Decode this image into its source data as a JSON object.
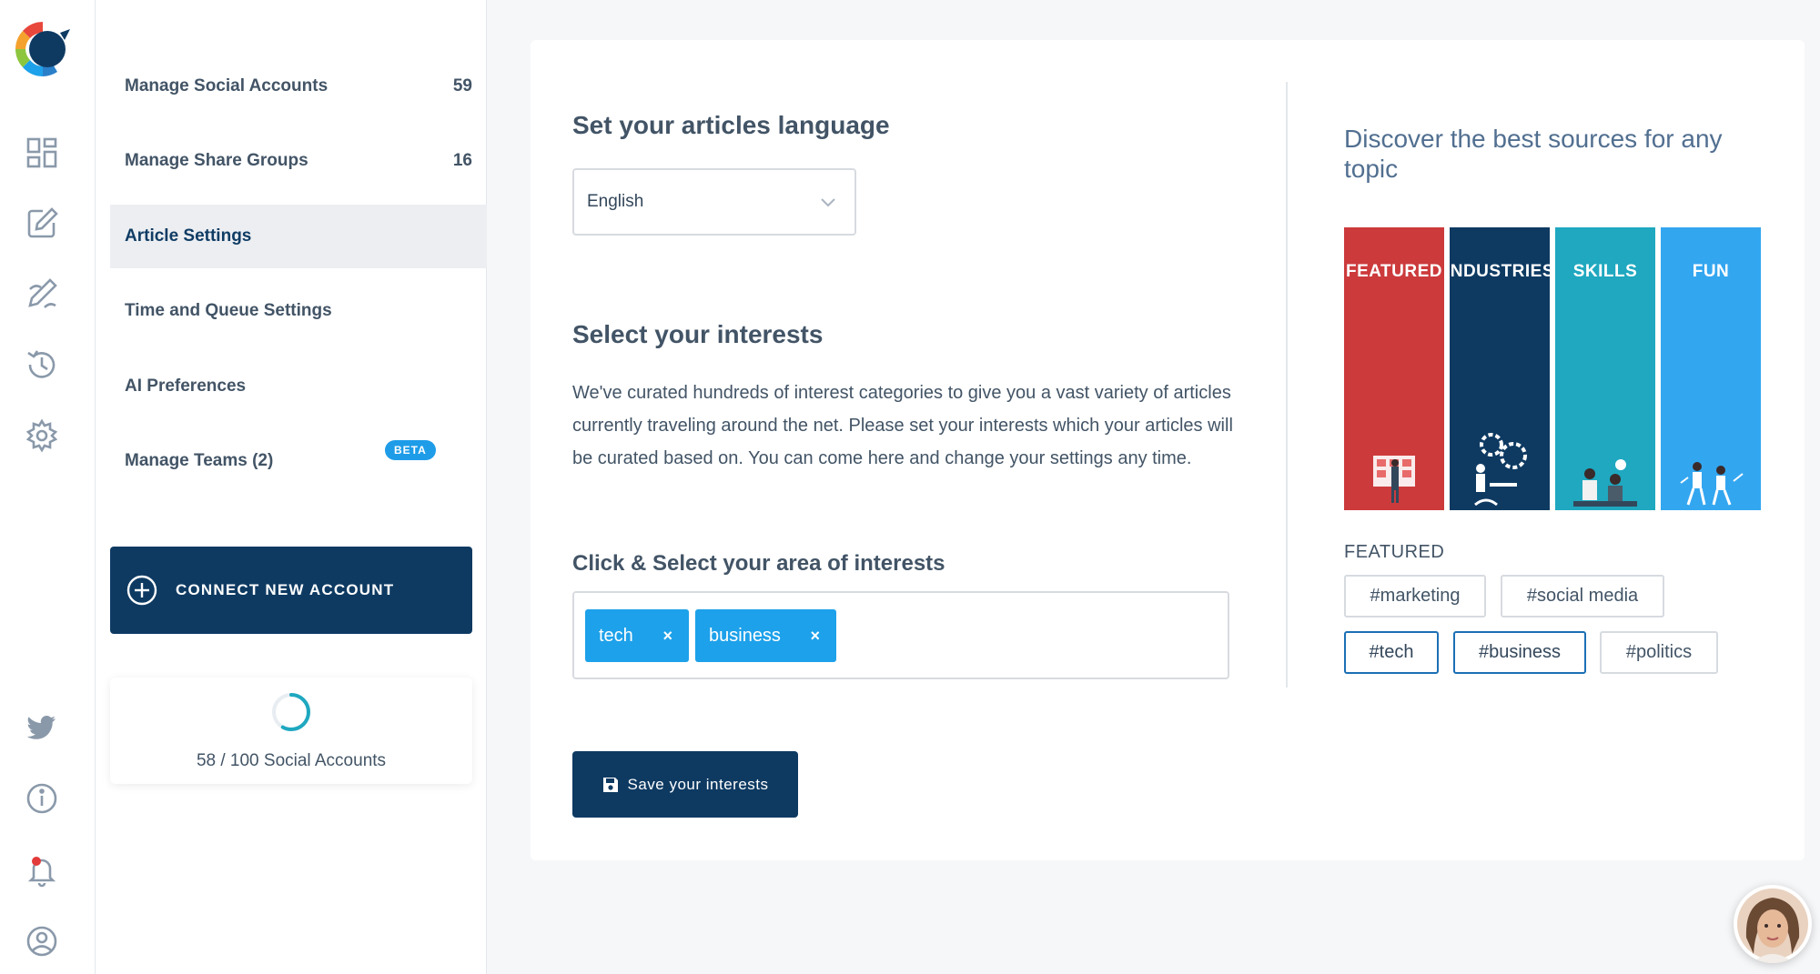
{
  "sidebar": {
    "items": [
      {
        "label": "Manage Social Accounts",
        "count": "59"
      },
      {
        "label": "Manage Share Groups",
        "count": "16"
      },
      {
        "label": "Article Settings"
      },
      {
        "label": "Time and Queue Settings"
      },
      {
        "label": "AI Preferences"
      },
      {
        "label": "Manage Teams (2)",
        "badge": "BETA"
      }
    ],
    "connect_label": "CONNECT NEW ACCOUNT",
    "accounts_usage": "58 / 100 Social Accounts",
    "accounts_used": 58,
    "accounts_total": 100
  },
  "rail_icons": [
    "dashboard-icon",
    "compose-icon",
    "draft-edit-icon",
    "history-icon",
    "settings-gear-icon",
    "twitter-icon",
    "info-icon",
    "notifications-bell-icon",
    "profile-icon"
  ],
  "main": {
    "language_heading": "Set your articles language",
    "language_value": "English",
    "interests_heading": "Select your interests",
    "interests_description": "We've curated hundreds of interest categories to give you a vast variety of articles currently traveling around the net. Please set your interests which your articles will be curated based on. You can come here and change your settings any time.",
    "area_heading": "Click & Select your area of interests",
    "selected_tags": [
      "tech",
      "business"
    ],
    "remove_symbol": "×",
    "save_label": "Save your interests"
  },
  "discover": {
    "title": "Discover the best sources for any topic",
    "tiles": [
      {
        "label": "FEATURED",
        "color": "#cc3a3c"
      },
      {
        "label": "INDUSTRIES",
        "color": "#0e3a62"
      },
      {
        "label": "SKILLS",
        "color": "#1fa8c0"
      },
      {
        "label": "FUN",
        "color": "#33a6f0"
      }
    ],
    "featured_label": "FEATURED",
    "hashtags": [
      {
        "label": "#marketing",
        "selected": false
      },
      {
        "label": "#social media",
        "selected": false
      },
      {
        "label": "#tech",
        "selected": true
      },
      {
        "label": "#business",
        "selected": true
      },
      {
        "label": "#politics",
        "selected": false
      }
    ]
  },
  "colors": {
    "brand_navy": "#0e3a62",
    "chip_blue": "#1da1ea",
    "page_bg": "#f6f7f9"
  }
}
